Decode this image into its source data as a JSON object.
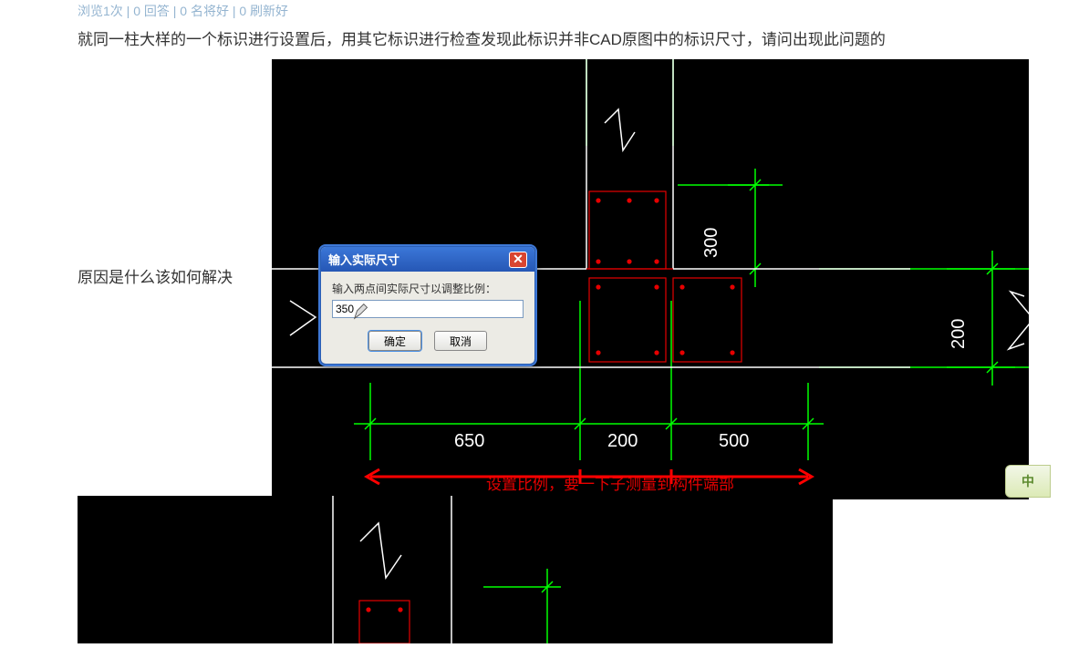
{
  "stats_text": "浏览1次 | 0 回答 | 0 名将好 | 0 刷新好",
  "question_line1": "就同一柱大样的一个标识进行设置后，用其它标识进行检查发现此标识并非CAD原图中的标识尺寸，请问出现此问题的",
  "question_line2": "原因是什么该如何解决",
  "cad": {
    "dims": {
      "d650": "650",
      "d200h": "200",
      "d500": "500",
      "d300v": "300",
      "d200v": "200"
    },
    "red_note": "设置比例，要一下子测量到构件端部"
  },
  "dialog": {
    "title": "输入实际尺寸",
    "label": "输入两点间实际尺寸以调整比例：",
    "value": "350",
    "ok": "确定",
    "cancel": "取消"
  },
  "ime_label": "中"
}
